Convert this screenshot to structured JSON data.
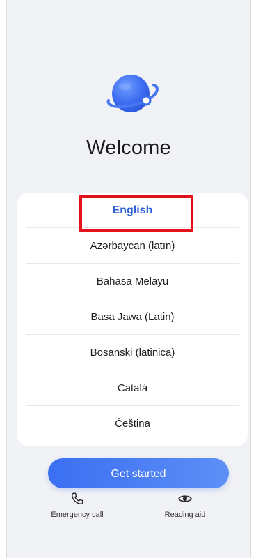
{
  "welcome": {
    "title": "Welcome",
    "logo_icon": "globe-planet-icon"
  },
  "language_list": {
    "items": [
      {
        "label": "English",
        "selected": true
      },
      {
        "label": "Azərbaycan (latın)",
        "selected": false
      },
      {
        "label": "Bahasa Melayu",
        "selected": false
      },
      {
        "label": "Basa Jawa (Latin)",
        "selected": false
      },
      {
        "label": "Bosanski (latinica)",
        "selected": false
      },
      {
        "label": "Català",
        "selected": false
      },
      {
        "label": "Čeština",
        "selected": false
      }
    ]
  },
  "actions": {
    "get_started": "Get started",
    "emergency_call": {
      "label": "Emergency call",
      "icon": "phone-icon"
    },
    "reading_aid": {
      "label": "Reading aid",
      "icon": "eye-icon"
    }
  },
  "colors": {
    "accent": "#2f62d6",
    "button": "#3a6ff2",
    "highlight": "#e3121c",
    "background": "#f1f2f5"
  }
}
